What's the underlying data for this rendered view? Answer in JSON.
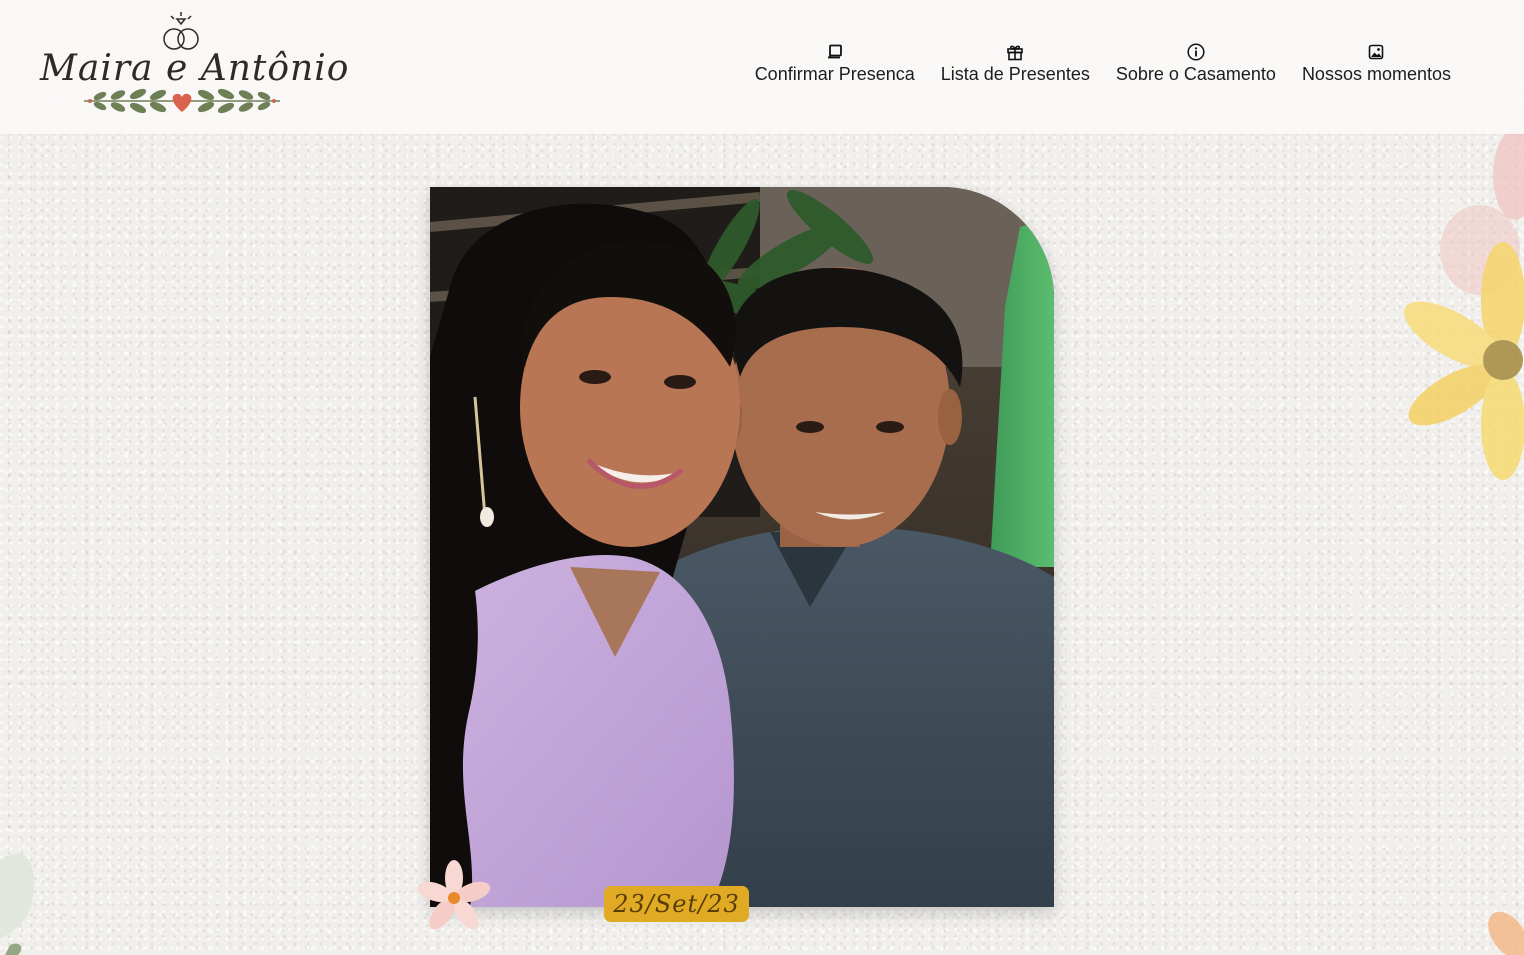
{
  "logo": {
    "text": "Maira e Antônio",
    "icon": "wedding-rings-icon",
    "ornament": "heart-laurel-icon"
  },
  "nav": {
    "items": [
      {
        "label": "Confirmar Presenca",
        "icon": "rsvp-card-icon"
      },
      {
        "label": "Lista de Presentes",
        "icon": "gift-icon"
      },
      {
        "label": "Sobre o Casamento",
        "icon": "info-icon"
      },
      {
        "label": "Nossos momentos",
        "icon": "image-icon"
      }
    ]
  },
  "hero": {
    "photo": "couple-photo",
    "date": "23/Set/23",
    "date_color": "#e0aa24"
  },
  "colors": {
    "background": "#f1efec",
    "heart": "#d9634c",
    "leaf": "#6e7f56"
  }
}
